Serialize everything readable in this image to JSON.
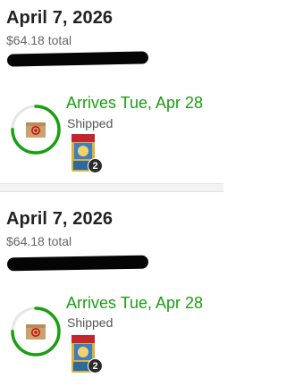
{
  "orders": [
    {
      "date": "April 7, 2026",
      "total": "$64.18 total",
      "arrival": "Arrives Tue, Apr 28",
      "status": "Shipped",
      "item_count": "2",
      "progress": 0.75
    },
    {
      "date": "April 7, 2026",
      "total": "$64.18 total",
      "arrival": "Arrives Tue, Apr 28",
      "status": "Shipped",
      "item_count": "2",
      "progress": 0.75
    }
  ],
  "colors": {
    "accent_green": "#1a9e12",
    "ring_track": "#e6e6e6",
    "package_brown": "#c9a26e",
    "target_red": "#cc0000"
  }
}
